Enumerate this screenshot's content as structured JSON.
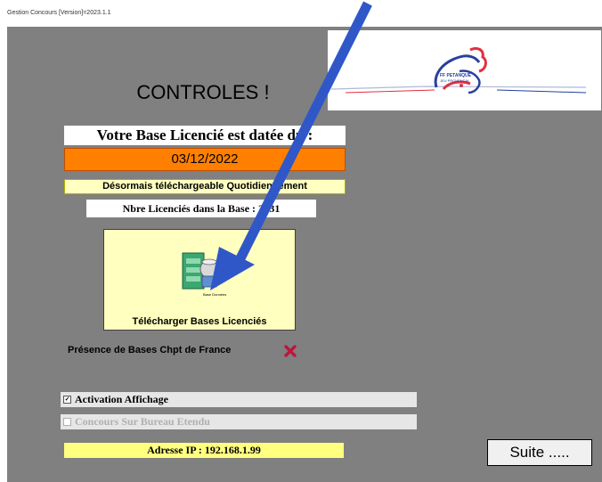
{
  "window": {
    "title": "Gestion Concours [Version]=2023.1.1"
  },
  "header": {
    "heading": "CONTROLES !",
    "logo_text_line1": "FF PETANQUE",
    "logo_text_line2": "JEU PROVENCAL"
  },
  "base": {
    "title": "Votre Base Licencié est datée du :",
    "date": "03/12/2022",
    "note": "Désormais téléchargeable Quotidiennement",
    "count_label": "Nbre Licenciés dans la Base : 2 /31"
  },
  "download_button": {
    "label": "Télécharger Bases Licenciés",
    "icon_caption": "Base Données"
  },
  "championship": {
    "label": "Présence de Bases Chpt de France"
  },
  "options": {
    "activation": {
      "label": "Activation Affichage",
      "checked_mark": "✓"
    },
    "bureau": {
      "label": "Concours Sur Bureau Etendu"
    }
  },
  "network": {
    "ip_label": "Adresse IP : 192.168.1.99"
  },
  "actions": {
    "next_label": "Suite ....."
  },
  "colors": {
    "background": "#808080",
    "date_bg": "#ff8000",
    "note_bg": "#ffffc0",
    "ip_bg": "#ffff80",
    "arrow": "#2f57c8",
    "cross": "#c0143c"
  }
}
